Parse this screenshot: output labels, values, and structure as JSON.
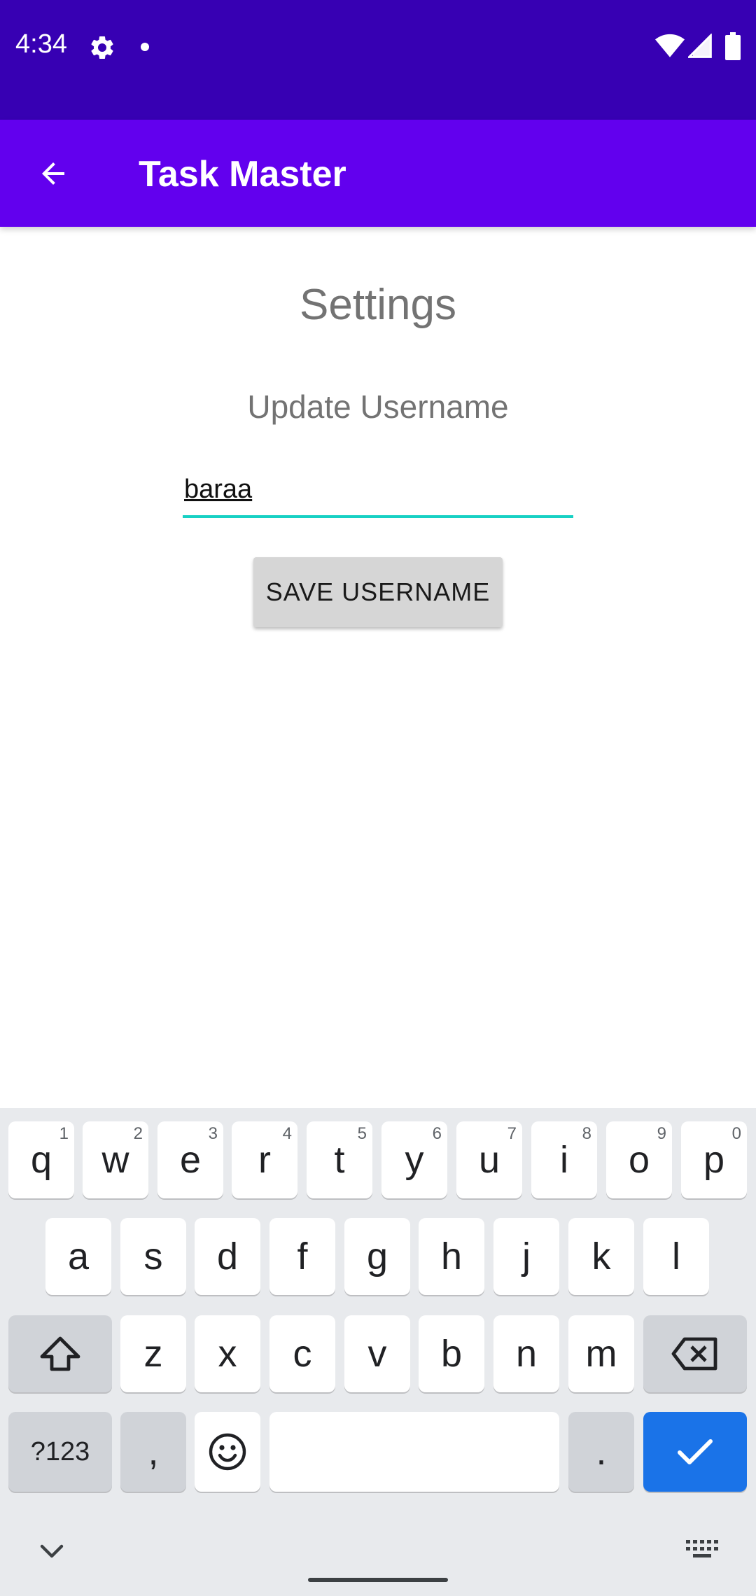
{
  "status_bar": {
    "time": "4:34",
    "icons": [
      "gear-icon",
      "notification-dot-icon",
      "wifi-icon",
      "cell-signal-icon",
      "battery-icon"
    ],
    "background": "#3700b3"
  },
  "app_bar": {
    "title": "Task Master",
    "back_icon": "arrow-back-icon",
    "background": "#6200ee"
  },
  "content": {
    "heading": "Settings",
    "update_label": "Update Username",
    "username_value": "baraa",
    "underline_color": "#17d1c4",
    "save_button_label": "SAVE USERNAME"
  },
  "keyboard": {
    "row1": [
      {
        "label": "q",
        "hint": "1"
      },
      {
        "label": "w",
        "hint": "2"
      },
      {
        "label": "e",
        "hint": "3"
      },
      {
        "label": "r",
        "hint": "4"
      },
      {
        "label": "t",
        "hint": "5"
      },
      {
        "label": "y",
        "hint": "6"
      },
      {
        "label": "u",
        "hint": "7"
      },
      {
        "label": "i",
        "hint": "8"
      },
      {
        "label": "o",
        "hint": "9"
      },
      {
        "label": "p",
        "hint": "0"
      }
    ],
    "row2": [
      "a",
      "s",
      "d",
      "f",
      "g",
      "h",
      "j",
      "k",
      "l"
    ],
    "row3": [
      "z",
      "x",
      "c",
      "v",
      "b",
      "n",
      "m"
    ],
    "symbols_label": "?123",
    "comma_label": ",",
    "period_label": ".",
    "icons": [
      "shift-icon",
      "backspace-icon",
      "emoji-icon",
      "check-icon",
      "chevron-down-icon",
      "keyboard-icon"
    ],
    "enter_color": "#1a73e8"
  }
}
